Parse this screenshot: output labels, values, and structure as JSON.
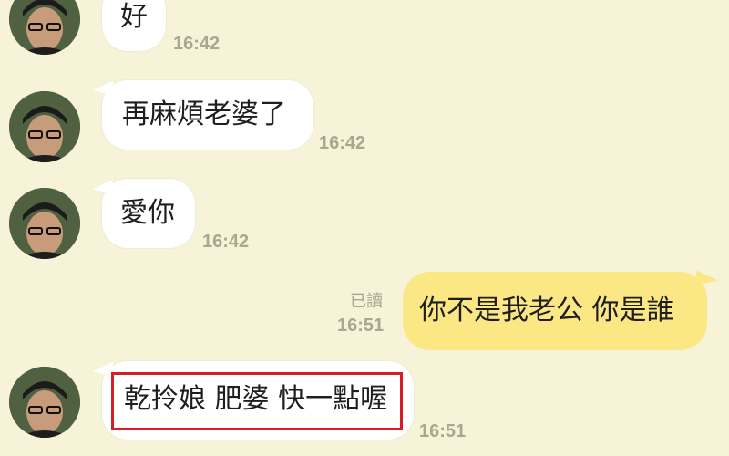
{
  "messages": [
    {
      "text": "好",
      "time": "16:42"
    },
    {
      "text": "再麻煩老婆了",
      "time": "16:42"
    },
    {
      "text": "愛你",
      "time": "16:42"
    },
    {
      "text": "你不是我老公 你是誰",
      "time": "16:51",
      "status": "已讀"
    },
    {
      "text": "乾拎娘 肥婆 快一點喔",
      "time": "16:51"
    }
  ],
  "colors": {
    "background": "#f7f3d9",
    "incoming_bubble": "#ffffff",
    "outgoing_bubble": "#fbe784",
    "timestamp": "#a9a78e",
    "highlight_box": "#d61f25"
  },
  "icons": {
    "avatar": "user-avatar-photo"
  }
}
